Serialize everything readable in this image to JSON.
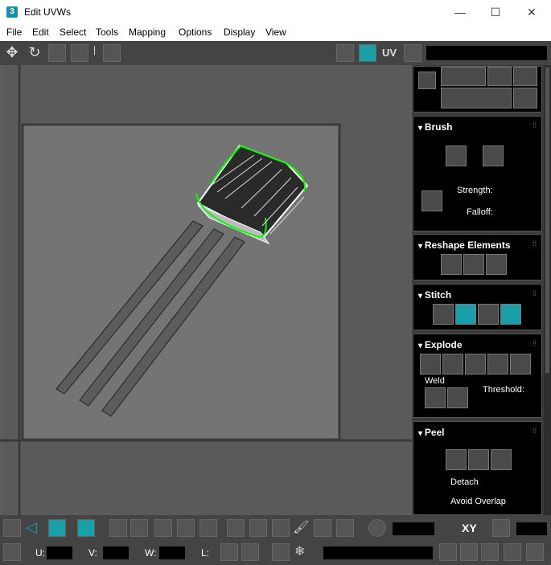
{
  "window": {
    "title": "Edit UVWs",
    "app_icon": "3",
    "min": "—",
    "max": "☐",
    "close": "✕"
  },
  "menu": [
    "File",
    "Edit",
    "Select",
    "Tools",
    "Mapping",
    "Options",
    "Display",
    "View"
  ],
  "toolbar": {
    "uv_label": "UV"
  },
  "brush": {
    "title": "Brush",
    "strength_label": "Strength:",
    "falloff_label": "Falloff:"
  },
  "reshape": {
    "title": "Reshape Elements"
  },
  "stitch": {
    "title": "Stitch"
  },
  "explode": {
    "title": "Explode",
    "weld_label": "Weld",
    "threshold_label": "Threshold:"
  },
  "peel": {
    "title": "Peel",
    "detach_label": "Detach",
    "avoid_overlap_label": "Avoid Overlap"
  },
  "bottom": {
    "xy_label": "XY",
    "u_label": "U:",
    "v_label": "V:",
    "w_label": "W:",
    "l_label": "L:"
  },
  "colors": {
    "accent": "#1a9ea8",
    "selection": "#00ff00"
  }
}
